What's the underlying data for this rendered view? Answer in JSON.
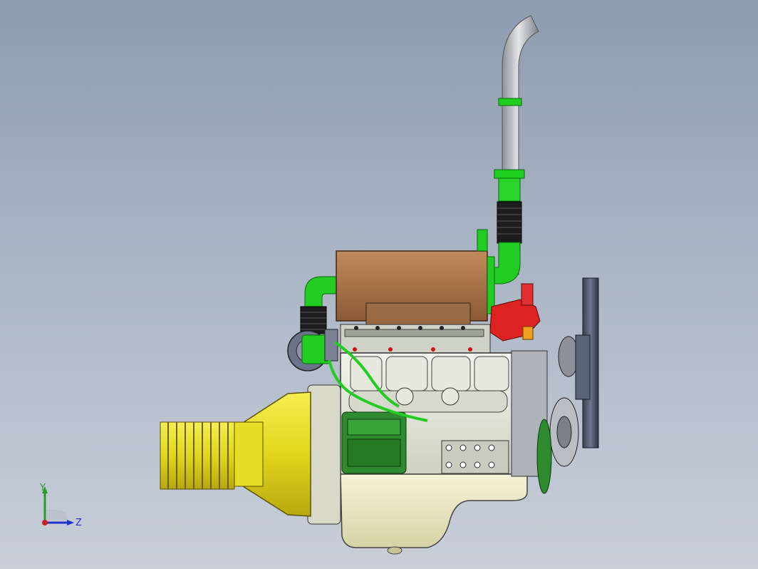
{
  "viewport": {
    "model": "engine-assembly",
    "background_top": "#8e9cb0",
    "background_bottom": "#c8cfd9"
  },
  "triad": {
    "y_label": "Y",
    "z_label": "Z",
    "colors": {
      "y": "#2a9a2a",
      "z": "#2233cc",
      "x": "#cc2222"
    }
  },
  "parts": {
    "exhaust_pipe": "#b8bcc0",
    "pipe_joints": "#22cc22",
    "intake_manifold": "#a8724a",
    "block": "#e8eadc",
    "oil_pan": "#f0eecc",
    "flywheel_housing": "#e8e020",
    "starter": "#2e8a2e",
    "thermostat": "#dd2222",
    "fan": "#5a6478",
    "pulleys": "#9aa0a8"
  }
}
